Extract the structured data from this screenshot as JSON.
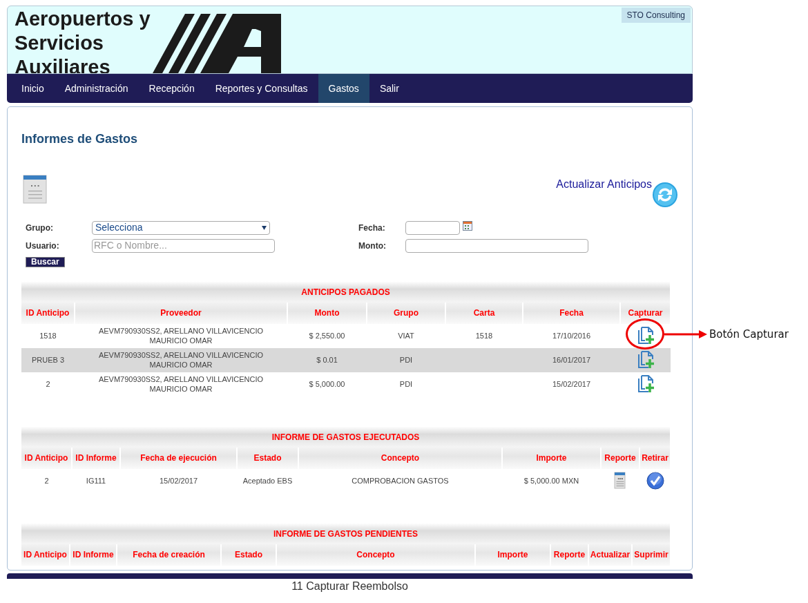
{
  "header": {
    "logo_lines": [
      "Aeropuertos y",
      "Servicios",
      "Auxiliares"
    ],
    "company": "STO Consulting"
  },
  "nav": [
    {
      "label": "Inicio",
      "selected": false
    },
    {
      "label": "Administración",
      "selected": false
    },
    {
      "label": "Recepción",
      "selected": false
    },
    {
      "label": "Reportes y Consultas",
      "selected": false
    },
    {
      "label": "Gastos",
      "selected": true
    },
    {
      "label": "Salir",
      "selected": false
    }
  ],
  "title": "Informes de Gastos",
  "refresh_link": "Actualizar Anticipos",
  "filters": [
    {
      "label": "Grupo:",
      "kind": "select",
      "value": "Selecciona"
    },
    {
      "label": "Fecha:",
      "kind": "date"
    },
    {
      "label": "Usuario:",
      "kind": "text",
      "placeholder": "RFC o Nombre..."
    },
    {
      "label": "Monto:",
      "kind": "text"
    }
  ],
  "search_button": "Buscar",
  "tables": [
    {
      "title": "ANTICIPOS PAGADOS",
      "columns": [
        {
          "label": "ID Anticipo",
          "kind": "text"
        },
        {
          "label": "Proveedor",
          "kind": "text"
        },
        {
          "label": "Monto",
          "kind": "text"
        },
        {
          "label": "Grupo",
          "kind": "text"
        },
        {
          "label": "Carta",
          "kind": "text"
        },
        {
          "label": "Fecha",
          "kind": "text"
        },
        {
          "label": "Capturar",
          "kind": "add"
        }
      ],
      "rows": [
        {
          "cells": [
            "1518",
            "AEVM790930SS2, ARELLANO VILLAVICENCIO MAURICIO OMAR",
            "$ 2,550.00",
            "VIAT",
            "1518",
            "17/10/2016"
          ]
        },
        {
          "cells": [
            "PRUEB 3",
            "AEVM790930SS2, ARELLANO VILLAVICENCIO MAURICIO OMAR",
            "$ 0.01",
            "PDI",
            "",
            "16/01/2017"
          ]
        },
        {
          "cells": [
            "2",
            "AEVM790930SS2, ARELLANO VILLAVICENCIO MAURICIO OMAR",
            "$ 5,000.00",
            "PDI",
            "",
            "15/02/2017"
          ]
        }
      ]
    },
    {
      "title": "INFORME DE GASTOS EJECUTADOS",
      "columns": [
        {
          "label": "ID Anticipo",
          "kind": "text"
        },
        {
          "label": "ID Informe",
          "kind": "text"
        },
        {
          "label": "Fecha de ejecución",
          "kind": "text"
        },
        {
          "label": "Estado",
          "kind": "text"
        },
        {
          "label": "Concepto",
          "kind": "text"
        },
        {
          "label": "Importe",
          "kind": "text"
        },
        {
          "label": "Reporte",
          "kind": "report"
        },
        {
          "label": "Retirar",
          "kind": "check"
        }
      ],
      "rows": [
        {
          "cells": [
            "2",
            "IG111",
            "15/02/2017",
            "Aceptado EBS",
            "COMPROBACION GASTOS",
            "$ 5,000.00 MXN"
          ]
        }
      ]
    },
    {
      "title": "INFORME DE GASTOS PENDIENTES",
      "columns": [
        {
          "label": "ID Anticipo"
        },
        {
          "label": "ID Informe"
        },
        {
          "label": "Fecha de creación"
        },
        {
          "label": "Estado"
        },
        {
          "label": "Concepto"
        },
        {
          "label": "Importe"
        },
        {
          "label": "Reporte"
        },
        {
          "label": "Actualizar"
        },
        {
          "label": "Suprimir"
        }
      ]
    }
  ],
  "annotation": {
    "text": "Botón Capturar"
  },
  "caption": "11 Capturar Reembolso"
}
